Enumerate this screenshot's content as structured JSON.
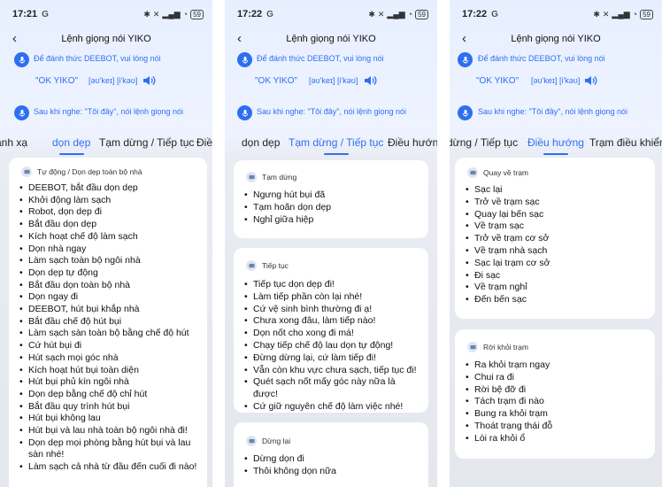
{
  "status": {
    "time": "17:21",
    "time_b": "17:22",
    "carrier": "G",
    "battery": "59"
  },
  "header": {
    "title": "Lệnh giọng nói YIKO"
  },
  "wake": {
    "text": "Để đánh thức DEEBOT, vui lòng nói",
    "phrase": "\"OK YIKO\"",
    "ipa": "[əʊ'keɪ] [i'kəʊ]"
  },
  "after": {
    "text": "Sau khi nghe: \"Tôi đây\", nói lệnh giọng nói"
  },
  "tabs": {
    "clean_all_partial": "ành xạ",
    "clean": "dọn dẹp",
    "pause": "Tạm dừng / Tiếp tục",
    "pause_partial": "dừng / Tiếp tục",
    "nav_partial": "Điều hư",
    "nav": "Điều hướng",
    "dock_partial": "Trạm điều khiển"
  },
  "screen1": {
    "card_title": "Tự động / Dọn dẹp toàn bộ nhà",
    "commands": [
      "DEEBOT, bắt đầu dọn dẹp",
      "Khởi động làm sạch",
      "Robot, dọn dẹp đi",
      "Bắt đầu dọn dẹp",
      "Kích hoạt chế độ làm sạch",
      "Dọn nhà ngay",
      "Làm sạch toàn bộ ngôi nhà",
      "Dọn dẹp tự động",
      "Bắt đầu dọn toàn bộ nhà",
      "Dọn ngay đi",
      "DEEBOT, hút bụi khắp nhà",
      "Bắt đầu chế độ hút bụi",
      "Làm sạch sàn toàn bộ bằng chế độ hút",
      "Cứ hút bụi đi",
      "Hút sạch mọi góc nhà",
      "Kích hoạt hút bụi toàn diện",
      "Hút bụi phủ kín ngôi nhà",
      "Dọn dẹp bằng chế độ chỉ hút",
      "Bắt đầu quy trình hút bụi",
      "Hút bụi không lau",
      "Hút bụi và lau nhà toàn bộ ngôi nhà đi!",
      "Dọn dẹp mọi phòng bằng hút bụi và lau sàn nhé!",
      "Làm sạch cả nhà từ đầu đến cuối đi nào!"
    ]
  },
  "screen2": {
    "pause_title": "Tạm dừng",
    "pause_cmds": [
      "Ngưng hút bụi đã",
      "Tạm hoãn dọn dẹp",
      "Nghỉ giữa hiệp"
    ],
    "resume_title": "Tiếp tục",
    "resume_cmds": [
      "Tiếp tục dọn dẹp đi!",
      "Làm tiếp phần còn lại nhé!",
      "Cứ vệ sinh bình thường đi ạ!",
      "Chưa xong đâu, làm tiếp nào!",
      "Dọn nốt cho xong đi má!",
      "Chạy tiếp chế độ lau dọn tự động!",
      "Đừng dừng lại, cứ làm tiếp đi!",
      "Vẫn còn khu vực chưa sạch, tiếp tục đi!",
      "Quét sạch nốt mấy góc này nữa là được!",
      "Cứ giữ nguyên chế độ làm việc nhé!"
    ],
    "stop_title": "Dừng lại",
    "stop_cmds": [
      "Dừng dọn đi",
      "Thôi không dọn nữa"
    ]
  },
  "screen3": {
    "return_title": "Quay về trạm",
    "return_cmds": [
      "Sạc lại",
      "Trở về trạm sạc",
      "Quay lại bến sạc",
      "Về trạm sạc",
      "Trở về trạm cơ sở",
      "Về trạm nhà sạch",
      "Sạc lại trạm cơ sở",
      "Đi sạc",
      "Về trạm nghỉ",
      "Đến bến sạc"
    ],
    "leave_title": "Rời khỏi trạm",
    "leave_cmds": [
      "Ra khỏi trạm ngay",
      "Chui ra đi",
      "Rời bệ đỡ đi",
      "Tách trạm đi nào",
      "Bung ra khỏi trạm",
      "Thoát trạng thái đỗ",
      "Lòi ra khỏi ổ"
    ]
  },
  "colors": {
    "accent": "#2e6ff0"
  }
}
